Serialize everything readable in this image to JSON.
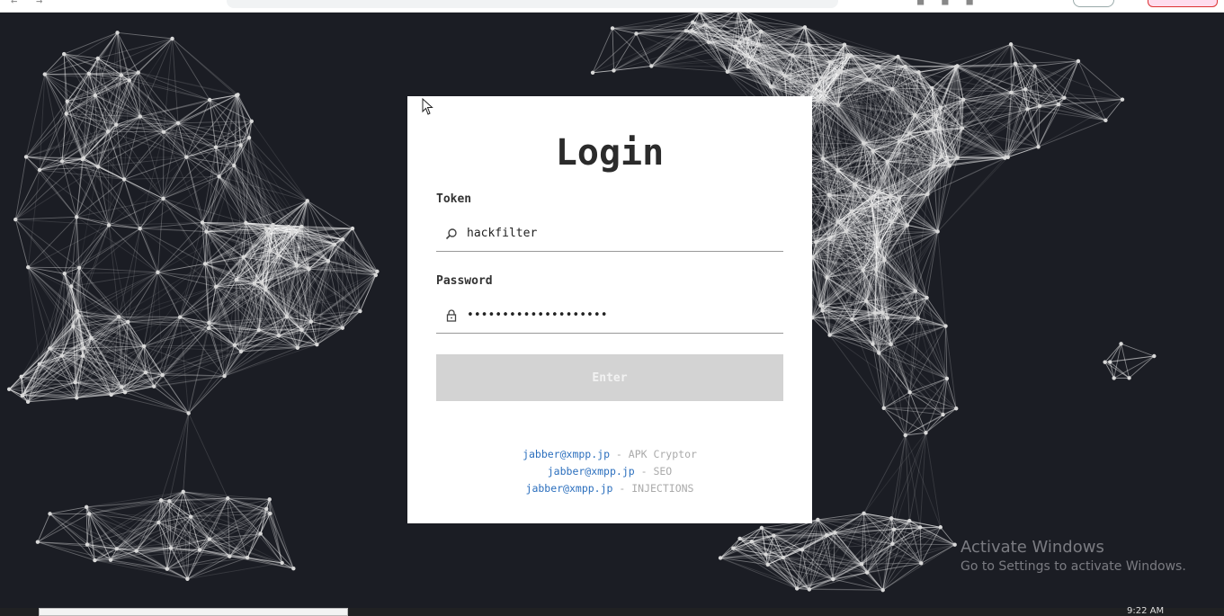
{
  "login": {
    "title": "Login",
    "token_label": "Token",
    "token_value": "hackfilter",
    "password_label": "Password",
    "password_value": "••••••••••••••••••••",
    "enter_label": "Enter"
  },
  "contacts": [
    {
      "address": "jabber@xmpp.jp",
      "service": " - APK Cryptor"
    },
    {
      "address": "jabber@xmpp.jp",
      "service": " - SEO"
    },
    {
      "address": "jabber@xmpp.jp",
      "service": " - INJECTIONS"
    }
  ],
  "watermark": {
    "title": "Activate Windows",
    "subtitle": "Go to Settings to activate Windows."
  },
  "taskbar": {
    "clock": "9:22 AM"
  },
  "icons": {
    "token": "search-icon",
    "password": "lock-icon",
    "cursor": "mouse-pointer-icon"
  },
  "colors": {
    "background": "#1b1d24",
    "card": "#ffffff",
    "button_disabled": "#d3d3d3",
    "link": "#2a6ebd"
  }
}
